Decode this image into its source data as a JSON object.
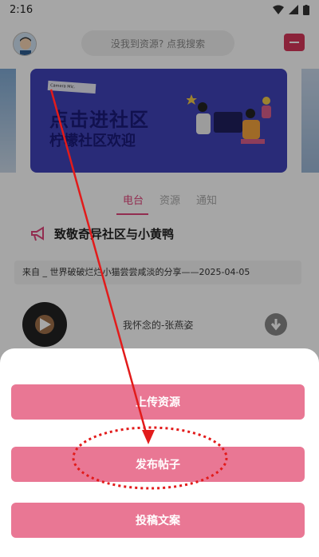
{
  "status": {
    "time": "2:16"
  },
  "header": {
    "search_placeholder": "没我到资源? 点我搜索"
  },
  "banner": {
    "tag": "Camera Mic.",
    "title_line1": "点击进社区",
    "title_line2": "柠檬社区欢迎"
  },
  "tabs": [
    {
      "label": "电台",
      "active": true
    },
    {
      "label": "资源",
      "active": false
    },
    {
      "label": "通知",
      "active": false
    }
  ],
  "announcement": {
    "text": "致敬奇异社区与小黄鸭"
  },
  "notice": {
    "text": "来自  _ 世界破破烂烂小猫尝尝咸淡的分享——2025-04-05"
  },
  "track": {
    "name": "我怀念的-张燕姿"
  },
  "sheet": {
    "upload": "上传资源",
    "post": "发布帖子",
    "submit": "投稿文案"
  },
  "colors": {
    "accent": "#e0457b",
    "button": "#e97794",
    "annotation": "#e21b1b"
  }
}
